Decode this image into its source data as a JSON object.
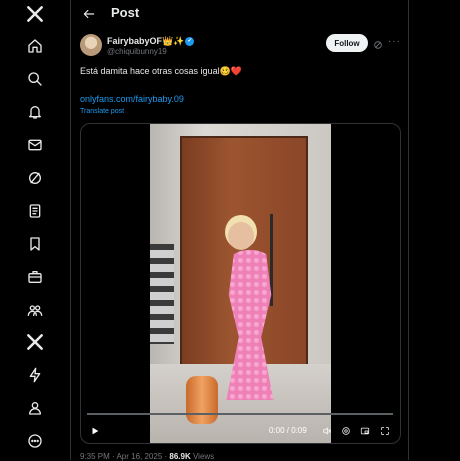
{
  "header": {
    "title": "Post"
  },
  "sidebar": {
    "items": [
      {
        "icon": "x-logo-icon"
      },
      {
        "icon": "home-icon"
      },
      {
        "icon": "search-icon"
      },
      {
        "icon": "notifications-icon"
      },
      {
        "icon": "messages-icon"
      },
      {
        "icon": "grok-icon"
      },
      {
        "icon": "lists-icon"
      },
      {
        "icon": "bookmarks-icon"
      },
      {
        "icon": "jobs-icon"
      },
      {
        "icon": "communities-icon"
      },
      {
        "icon": "premium-icon"
      },
      {
        "icon": "verified-orgs-icon"
      },
      {
        "icon": "profile-icon"
      },
      {
        "icon": "more-icon"
      }
    ]
  },
  "tweet": {
    "author_name": "FairybabyOF",
    "author_emoji": "👑✨",
    "handle": "@chiquibunny19",
    "follow_label": "Follow",
    "text": "Está damita hace otras cosas igual",
    "text_emoji": "🥴",
    "text_heart": "❤️",
    "link": "onlyfans.com/fairybaby.09",
    "translate": "Translate post",
    "meta_time": "9:35 PM · Apr 16, 2025 · ",
    "views_count": "86.9K",
    "views_label": " Views"
  },
  "video": {
    "time": "0:00 / 0:09",
    "progress": 0
  },
  "colors": {
    "accent": "#1d9bf0",
    "background": "#000000",
    "text": "#e7e9ea",
    "muted": "#71767b"
  }
}
